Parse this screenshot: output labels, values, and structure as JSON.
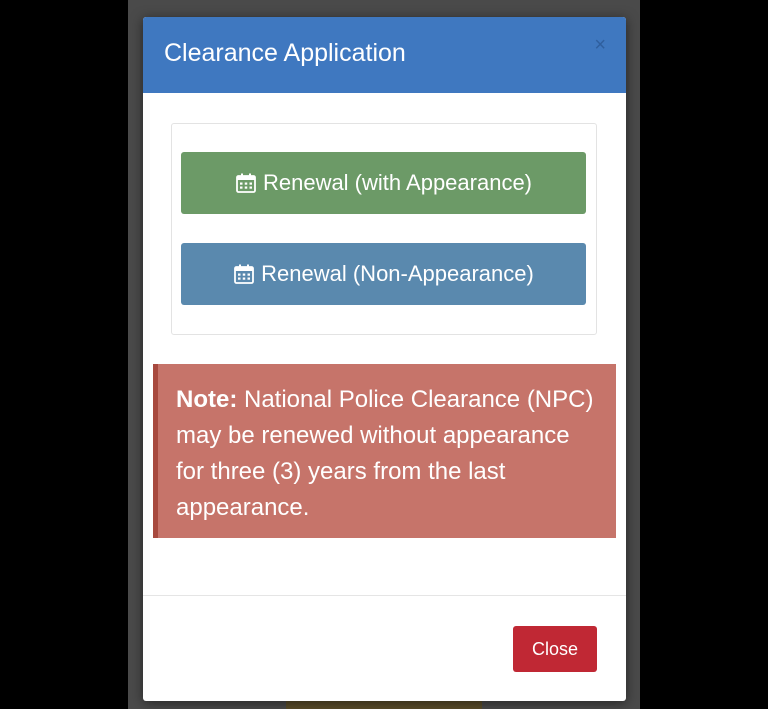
{
  "modal": {
    "title": "Clearance Application",
    "close_glyph": "×"
  },
  "options": [
    {
      "label": "Renewal (with Appearance)",
      "icon": "calendar-icon",
      "color": "#6c9a67"
    },
    {
      "label": "Renewal (Non-Appearance)",
      "icon": "calendar-icon",
      "color": "#5a89ae"
    }
  ],
  "note": {
    "label": "Note:",
    "text": " National Police Clearance (NPC) may be renewed without appearance for three (3) years from the last appearance."
  },
  "footer": {
    "close_label": "Close"
  },
  "colors": {
    "header": "#3f78c0",
    "note_bg": "#c6746a",
    "close_button": "#c02834"
  }
}
